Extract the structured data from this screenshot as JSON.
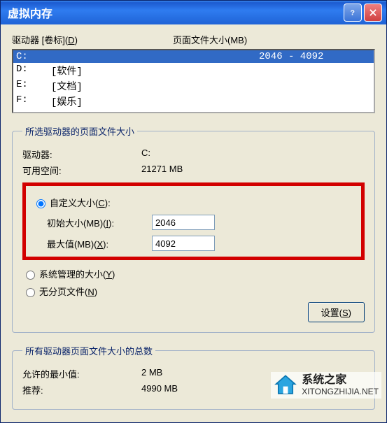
{
  "window": {
    "title": "虚拟内存"
  },
  "labels": {
    "drive_volume": "驱动器 [卷标](D)",
    "pagefile_size": "页面文件大小(MB)"
  },
  "drives": [
    {
      "letter": "C:",
      "label": "",
      "size": "2046 - 4092",
      "selected": true
    },
    {
      "letter": "D:",
      "label": "[软件]",
      "size": "",
      "selected": false
    },
    {
      "letter": "E:",
      "label": "[文档]",
      "size": "",
      "selected": false
    },
    {
      "letter": "F:",
      "label": "[娱乐]",
      "size": "",
      "selected": false
    }
  ],
  "selected_group": {
    "legend": "所选驱动器的页面文件大小",
    "drive_label": "驱动器:",
    "drive_value": "C:",
    "space_label": "可用空间:",
    "space_value": "21271 MB",
    "radio_custom": "自定义大小(C):",
    "initial_label": "初始大小(MB)(I):",
    "initial_value": "2046",
    "max_label": "最大值(MB)(X):",
    "max_value": "4092",
    "radio_system": "系统管理的大小(Y)",
    "radio_none": "无分页文件(N)",
    "set_button": "设置(S)"
  },
  "total_group": {
    "legend": "所有驱动器页面文件大小的总数",
    "min_label": "允许的最小值:",
    "min_value": "2 MB",
    "rec_label": "推荐:",
    "rec_value": "4990 MB"
  },
  "watermark": {
    "name": "系统之家",
    "url": "XITONGZHIJIA.NET"
  }
}
